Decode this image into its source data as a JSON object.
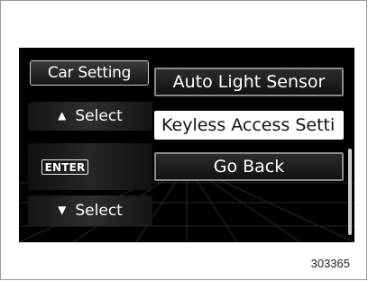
{
  "side_panel": {
    "title": "Car Setting",
    "select_up_label": "Select",
    "select_up_icon": "up-triangle-icon",
    "enter_label": "ENTER",
    "select_down_label": "Select",
    "select_down_icon": "down-triangle-icon"
  },
  "menu": {
    "items": [
      {
        "label": "Auto Light Sensor",
        "selected": false
      },
      {
        "label": "Keyless Access Setti",
        "selected": true
      },
      {
        "label": "Go Back",
        "selected": false
      }
    ]
  },
  "figure_number": "303365",
  "colors": {
    "screen_background": "#000000",
    "selected_item_background": "#ffffff",
    "border_gray": "#8a8a8a"
  }
}
